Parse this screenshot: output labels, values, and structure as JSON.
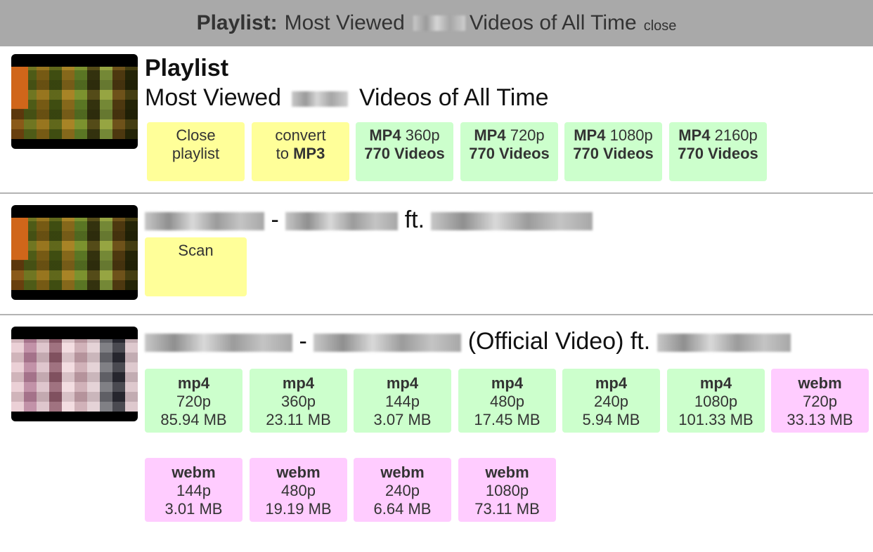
{
  "header": {
    "label": "Playlist:",
    "title_pre": "Most Viewed",
    "title_post": "Videos of All Time",
    "close": "close"
  },
  "playlist": {
    "heading": "Playlist",
    "title_pre": "Most Viewed",
    "title_post": "Videos of All Time",
    "buttons": [
      {
        "line1": "Close",
        "line2": "playlist",
        "color": "yellow"
      },
      {
        "line1": "convert",
        "line2_pre": "to",
        "line2_bold": "MP3",
        "color": "yellow"
      },
      {
        "fmt": "MP4",
        "res": "360p",
        "count": "770 Videos",
        "color": "green"
      },
      {
        "fmt": "MP4",
        "res": "720p",
        "count": "770 Videos",
        "color": "green"
      },
      {
        "fmt": "MP4",
        "res": "1080p",
        "count": "770 Videos",
        "color": "green"
      },
      {
        "fmt": "MP4",
        "res": "2160p",
        "count": "770 Videos",
        "color": "green"
      }
    ]
  },
  "video1": {
    "sep": "-",
    "ft": "ft.",
    "scan": "Scan"
  },
  "video2": {
    "sep": "-",
    "mid": "(Official Video) ft.",
    "formats": [
      {
        "fmt": "mp4",
        "res": "720p",
        "size": "85.94 MB"
      },
      {
        "fmt": "mp4",
        "res": "360p",
        "size": "23.11 MB"
      },
      {
        "fmt": "mp4",
        "res": "144p",
        "size": "3.07 MB"
      },
      {
        "fmt": "mp4",
        "res": "480p",
        "size": "17.45 MB"
      },
      {
        "fmt": "mp4",
        "res": "240p",
        "size": "5.94 MB"
      },
      {
        "fmt": "mp4",
        "res": "1080p",
        "size": "101.33 MB"
      },
      {
        "fmt": "webm",
        "res": "720p",
        "size": "33.13 MB"
      },
      {
        "fmt": "webm",
        "res": "144p",
        "size": "3.01 MB"
      },
      {
        "fmt": "webm",
        "res": "480p",
        "size": "19.19 MB"
      },
      {
        "fmt": "webm",
        "res": "240p",
        "size": "6.64 MB"
      },
      {
        "fmt": "webm",
        "res": "1080p",
        "size": "73.11 MB"
      }
    ]
  },
  "colors": {
    "yellow": "#ffff99",
    "green": "#ccffcc",
    "pink": "#ffccff",
    "topbar": "#a9a9a9"
  }
}
